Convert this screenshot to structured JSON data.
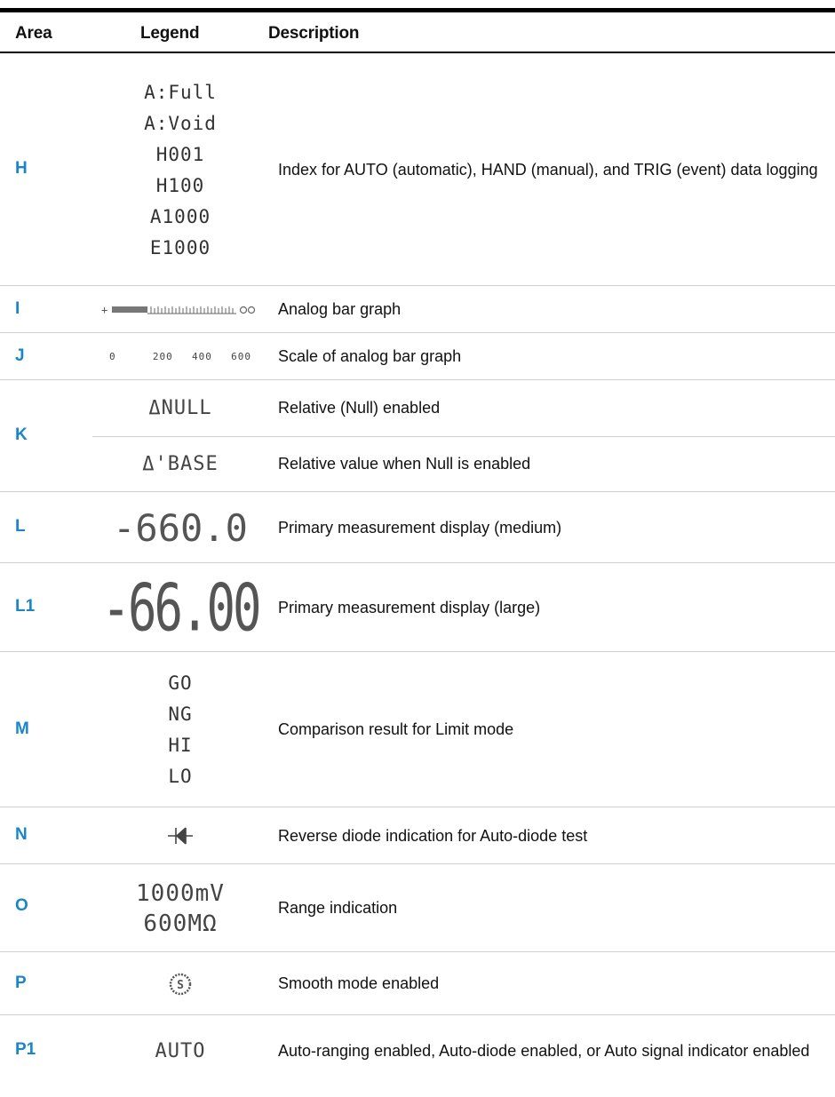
{
  "header": {
    "area": "Area",
    "legend": "Legend",
    "description": "Description"
  },
  "colors": {
    "area_label": "#1a86c8",
    "rule": "#000000"
  },
  "rows": [
    {
      "area": "H",
      "legend": [
        "A:Full",
        "A:Void",
        "H001",
        "H100",
        "A1000",
        "E1000"
      ],
      "description": "Index for AUTO (automatic), HAND (manual), and TRIG (event) data logging"
    },
    {
      "area": "I",
      "legend_icon": "analog-bar-graph-icon",
      "description": "Analog bar graph"
    },
    {
      "area": "J",
      "legend": [
        "0",
        "200",
        "400",
        "600"
      ],
      "description": "Scale of analog bar graph"
    },
    {
      "area": "K",
      "sub": [
        {
          "legend": "ΔNULL",
          "description": "Relative (Null) enabled"
        },
        {
          "legend": "Δ'BASE",
          "description": "Relative value when Null is enabled"
        }
      ]
    },
    {
      "area": "L",
      "legend": "-660.0",
      "description": "Primary measurement display (medium)"
    },
    {
      "area": "L1",
      "legend": "-66.00",
      "description": "Primary measurement display (large)"
    },
    {
      "area": "M",
      "legend": [
        "GO",
        "NG",
        "HI",
        "LO"
      ],
      "description": "Comparison result for Limit mode"
    },
    {
      "area": "N",
      "legend_icon": "reverse-diode-icon",
      "description": "Reverse diode indication for Auto-diode test"
    },
    {
      "area": "O",
      "legend": [
        "1000mV",
        "600MΩ"
      ],
      "description": "Range indication"
    },
    {
      "area": "P",
      "legend_icon": "smooth-mode-icon",
      "description": "Smooth mode enabled"
    },
    {
      "area": "P1",
      "legend": "AUTO",
      "description": "Auto-ranging enabled, Auto-diode enabled, or Auto signal indicator enabled"
    }
  ]
}
